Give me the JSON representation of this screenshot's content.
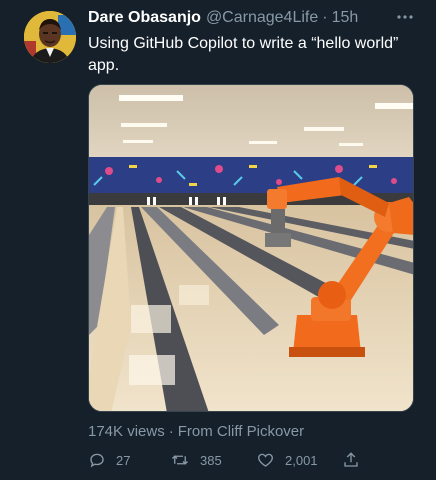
{
  "tweet": {
    "author_name": "Dare Obasanjo",
    "handle": "@Carnage4Life",
    "separator": "·",
    "time": "15h",
    "text": "Using GitHub Copilot to write a “hello world” app.",
    "more_icon": "more-horizontal-icon",
    "media": {
      "type": "video"
    },
    "meta": {
      "views": "174K views",
      "separator": "·",
      "source": "From Cliff Pickover"
    },
    "actions": {
      "reply_count": "27",
      "retweet_count": "385",
      "like_count": "2,001",
      "reply_icon": "reply-icon",
      "retweet_icon": "retweet-icon",
      "like_icon": "heart-icon",
      "share_icon": "share-icon"
    }
  },
  "colors": {
    "background": "#15202b",
    "primary_text": "#ffffff",
    "secondary_text": "#8899a6",
    "border": "#38444d",
    "robot_orange": "#f26b1d"
  }
}
